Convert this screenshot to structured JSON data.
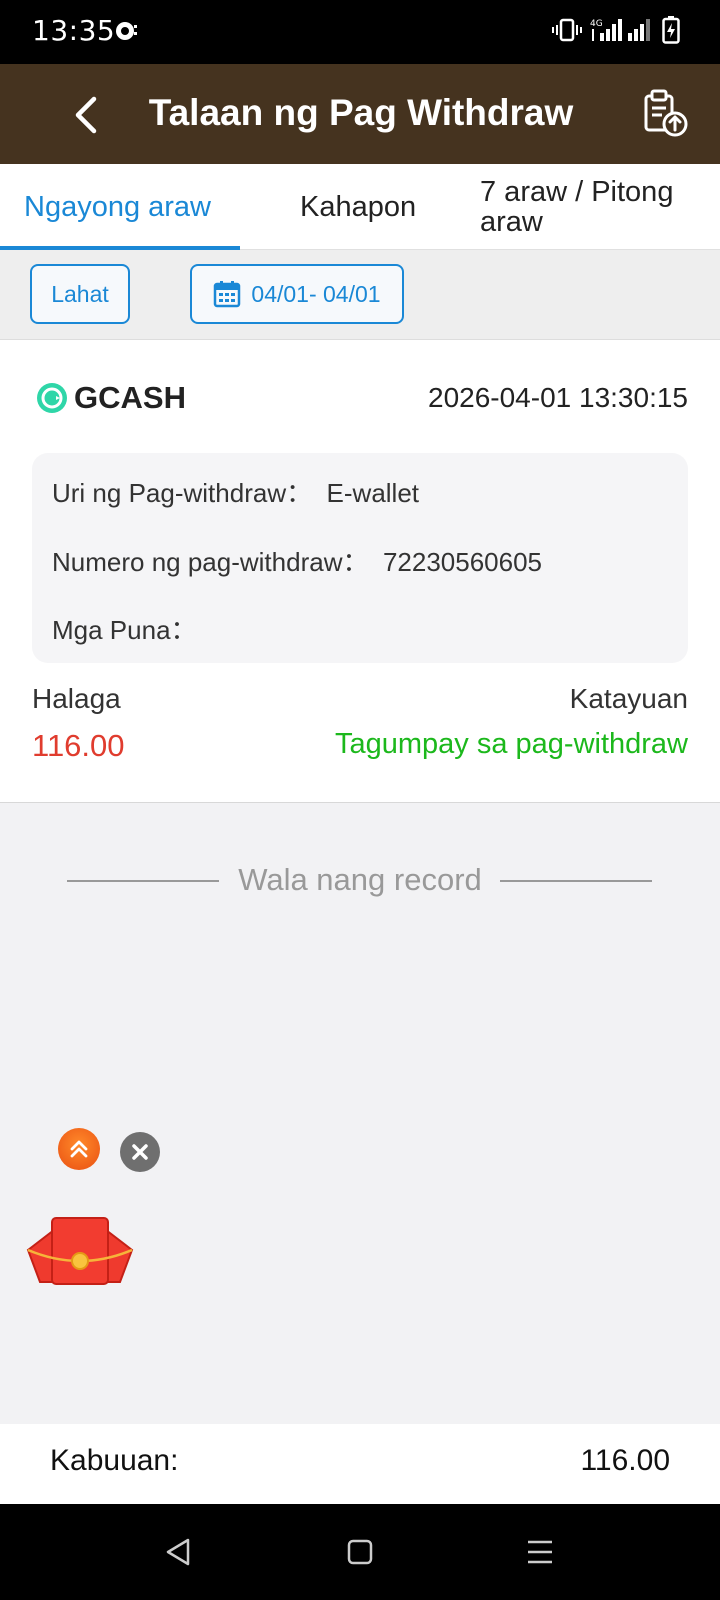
{
  "status_bar": {
    "time": "13:35",
    "network": "4G"
  },
  "header": {
    "title": "Talaan ng Pag Withdraw",
    "back_icon": "chevron-left-icon",
    "action_icon": "clipboard-upload-icon"
  },
  "tabs": [
    {
      "label": "Ngayong araw",
      "active": true
    },
    {
      "label": "Kahapon",
      "active": false
    },
    {
      "label": "7 araw / Pitong araw",
      "active": false
    }
  ],
  "filters": {
    "type_label": "Lahat",
    "date_range": "04/01- 04/01",
    "date_icon": "calendar-icon"
  },
  "record": {
    "provider": "GCASH",
    "datetime": "2026-04-01 13:30:15",
    "withdraw_type_label": "Uri ng Pag-withdraw：",
    "withdraw_type_value": "E-wallet",
    "withdraw_number_label": "Numero ng pag-withdraw：",
    "withdraw_number_value": "72230560605",
    "remarks_label": "Mga Puna：",
    "remarks_value": "",
    "amount_label": "Halaga",
    "amount_value": "116.00",
    "status_label": "Katayuan",
    "status_value": "Tagumpay sa pag-withdraw"
  },
  "list_end_text": "Wala nang record",
  "footer": {
    "total_label": "Kabuuan:",
    "total_value": "116.00"
  },
  "colors": {
    "header_bg": "#45331f",
    "accent": "#1a88d6",
    "amount": "#e03c2e",
    "success": "#1cb81c"
  }
}
